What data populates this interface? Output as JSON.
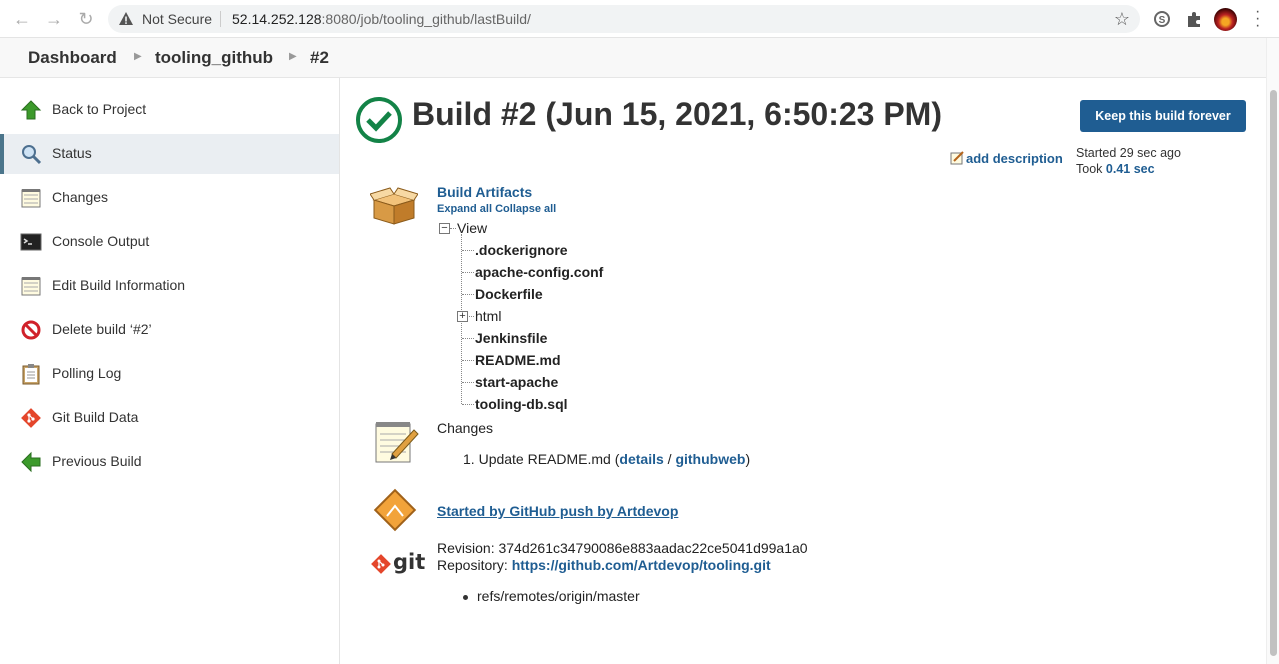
{
  "browser": {
    "security_label": "Not Secure",
    "url_host": "52.14.252.128",
    "url_rest": ":8080/job/tooling_github/lastBuild/"
  },
  "breadcrumb": {
    "items": [
      "Dashboard",
      "tooling_github",
      "#2"
    ]
  },
  "sidebar": {
    "items": [
      {
        "label": "Back to Project",
        "icon": "up-arrow-icon"
      },
      {
        "label": "Status",
        "icon": "magnifier-icon",
        "active": true
      },
      {
        "label": "Changes",
        "icon": "notepad-icon"
      },
      {
        "label": "Console Output",
        "icon": "terminal-icon"
      },
      {
        "label": "Edit Build Information",
        "icon": "notepad-icon"
      },
      {
        "label": "Delete build ‘#2’",
        "icon": "no-entry-icon"
      },
      {
        "label": "Polling Log",
        "icon": "clipboard-icon"
      },
      {
        "label": "Git Build Data",
        "icon": "git-icon"
      },
      {
        "label": "Previous Build",
        "icon": "left-arrow-icon"
      }
    ]
  },
  "main": {
    "title": "Build #2 (Jun 15, 2021, 6:50:23 PM)",
    "keep_button": "Keep this build forever",
    "add_description": "add description",
    "started": "Started 29 sec ago",
    "took_prefix": "Took ",
    "took_value": "0.41 sec",
    "artifacts": {
      "title": "Build Artifacts",
      "expand_all": "Expand all",
      "collapse_all": "Collapse all",
      "root": "View",
      "entries": [
        ".dockerignore",
        "apache-config.conf",
        "Dockerfile",
        "html",
        "Jenkinsfile",
        "README.md",
        "start-apache",
        "tooling-db.sql"
      ]
    },
    "changes": {
      "label": "Changes",
      "item_number": "1.",
      "item_text": "Update README.md (",
      "details": "details",
      "sep": " / ",
      "githubweb": "githubweb",
      "close": ")"
    },
    "started_by": "Started by GitHub push by Artdevop",
    "git": {
      "logo_text": "git",
      "revision_label": "Revision",
      "revision": "374d261c34790086e883aadac22ce5041d99a1a0",
      "repository_label": "Repository",
      "repository": "https://github.com/Artdevop/tooling.git",
      "branch": "refs/remotes/origin/master"
    }
  },
  "colors": {
    "link": "#1f5d92",
    "button": "#1f5d92",
    "success": "#138347"
  }
}
